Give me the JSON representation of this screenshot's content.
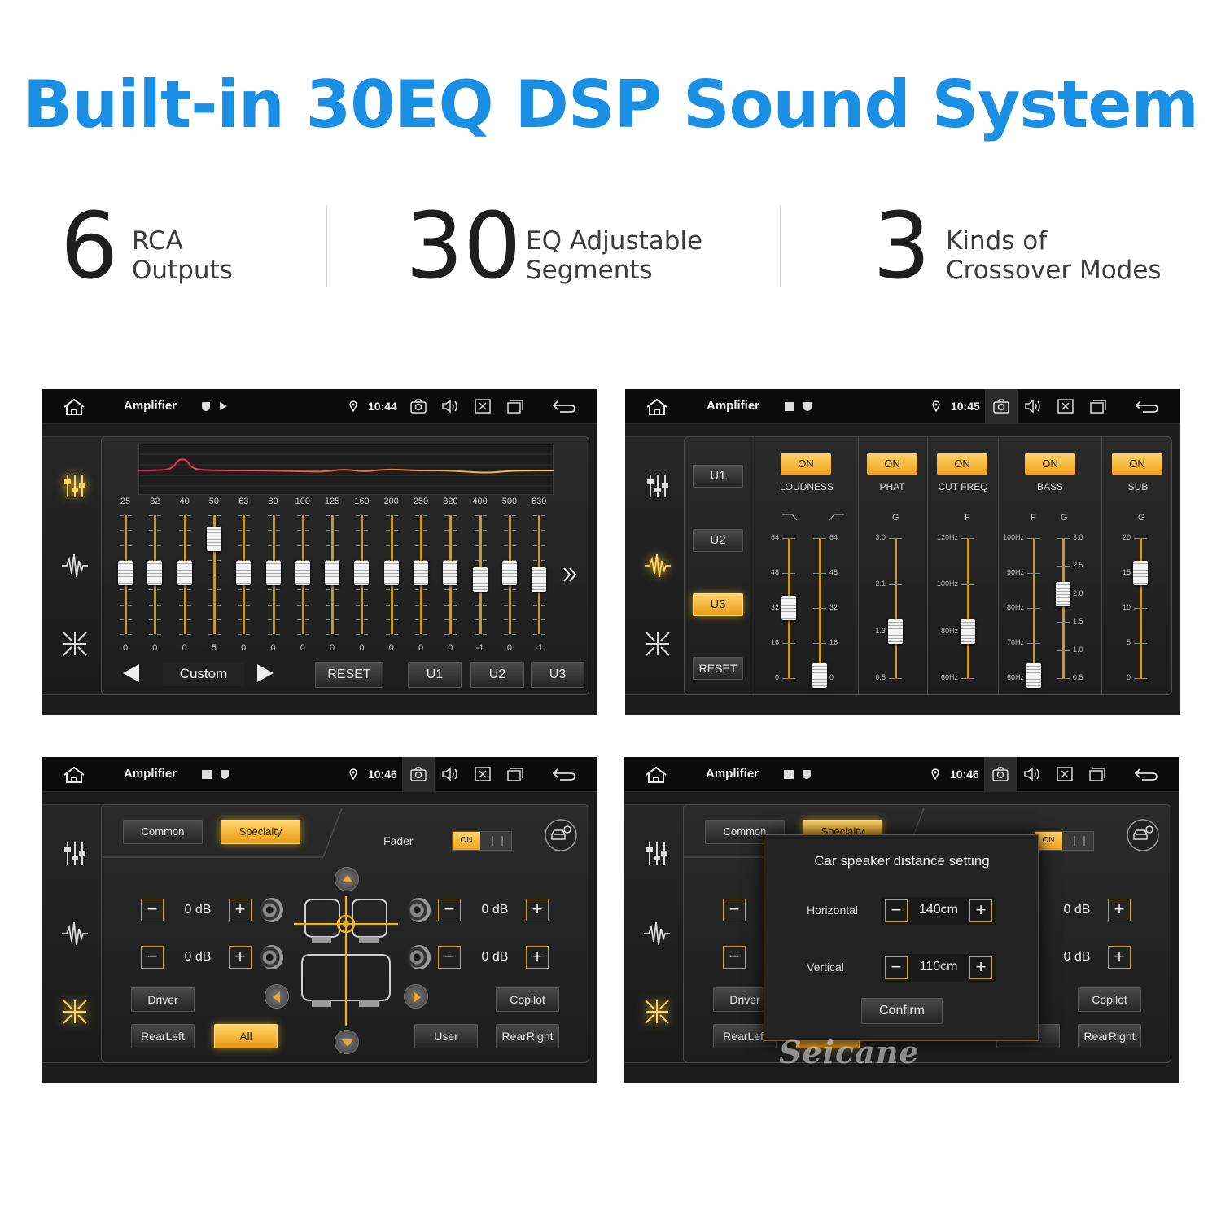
{
  "headline": "Built-in 30EQ DSP Sound System",
  "stats": [
    {
      "number": "6",
      "line1": "RCA",
      "line2": "Outputs"
    },
    {
      "number": "30",
      "line1": "EQ Adjustable",
      "line2": "Segments"
    },
    {
      "number": "3",
      "line1": "Kinds of",
      "line2": "Crossover Modes"
    }
  ],
  "status_bar": {
    "title": "Amplifier",
    "times": [
      "10:44",
      "10:45",
      "10:46",
      "10:46"
    ]
  },
  "eq_panel": {
    "freqs": [
      "25",
      "32",
      "40",
      "50",
      "63",
      "80",
      "100",
      "125",
      "160",
      "200",
      "250",
      "320",
      "400",
      "500",
      "630"
    ],
    "values": [
      "0",
      "0",
      "0",
      "5",
      "0",
      "0",
      "0",
      "0",
      "0",
      "0",
      "0",
      "0",
      "-1",
      "0",
      "-1"
    ],
    "levels": [
      0,
      0,
      0,
      5,
      0,
      0,
      0,
      0,
      0,
      0,
      0,
      0,
      -1,
      0,
      -1
    ],
    "preset": "Custom",
    "reset": "RESET",
    "presets": [
      "U1",
      "U2",
      "U3"
    ]
  },
  "crossover_panel": {
    "user_buttons": [
      "U1",
      "U2",
      "U3",
      "RESET"
    ],
    "selected": "U3",
    "on_label": "ON",
    "columns": [
      "LOUDNESS",
      "PHAT",
      "CUT FREQ",
      "BASS",
      "SUB"
    ],
    "g": "G",
    "f": "F",
    "loudness_scale": [
      "64",
      "48",
      "32",
      "16",
      "0"
    ],
    "phat_scale": [
      "3.0",
      "2.1",
      "1.3",
      "0.5"
    ],
    "cut_scale": [
      "120Hz",
      "100Hz",
      "80Hz",
      "60Hz"
    ],
    "bass_f_scale": [
      "100Hz",
      "90Hz",
      "80Hz",
      "70Hz",
      "60Hz"
    ],
    "bass_g_scale": [
      "3.0",
      "2.5",
      "2.0",
      "1.5",
      "1.0",
      "0.5"
    ],
    "sub_scale": [
      "20",
      "15",
      "10",
      "5",
      "0"
    ]
  },
  "balance_panel": {
    "tabs": [
      "Common",
      "Specialty"
    ],
    "fader_label": "Fader",
    "fader_toggle": "ON",
    "db_values": [
      "0 dB",
      "0 dB",
      "0 dB",
      "0 dB"
    ],
    "minus": "−",
    "plus": "+",
    "positions": [
      "Driver",
      "Copilot",
      "RearLeft",
      "All",
      "User",
      "RearRight"
    ]
  },
  "distance_panel": {
    "dialog_title": "Car speaker distance setting",
    "horizontal_label": "Horizontal",
    "horizontal_value": "140cm",
    "vertical_label": "Vertical",
    "vertical_value": "110cm",
    "confirm": "Confirm",
    "watermark": "Seicane"
  },
  "colors": {
    "headline": "#1a8fe3",
    "accent": "#f0a21a"
  }
}
